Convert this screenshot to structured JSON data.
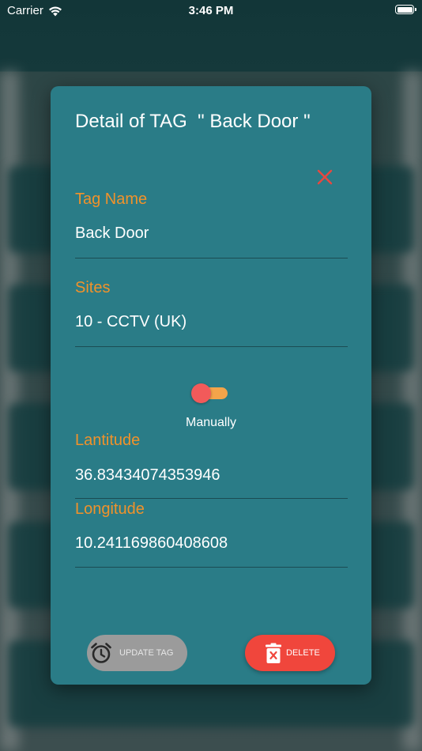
{
  "status_bar": {
    "carrier": "Carrier",
    "time": "3:46 PM"
  },
  "dialog": {
    "title": "Detail of TAG  \" Back Door \"",
    "close_icon": "close-icon",
    "fields": {
      "tag_name": {
        "label": "Tag Name",
        "value": "Back Door"
      },
      "sites": {
        "label": "Sites",
        "value": "10 - CCTV (UK)"
      },
      "latitude": {
        "label": "Lantitude",
        "value": "36.83434074353946"
      },
      "longitude": {
        "label": "Longitude",
        "value": "10.241169860408608"
      }
    },
    "toggle": {
      "caption": "Manually",
      "on": false
    },
    "buttons": {
      "update_label": "UPDATE TAG",
      "update_icon": "alarm-clock-icon",
      "delete_label": "DELETE",
      "delete_icon": "trash-icon"
    }
  },
  "colors": {
    "dialog_bg": "#2a7c87",
    "label": "#f1922a",
    "close": "#e8473f",
    "update_button": "#9b9b9b",
    "delete_button": "#f0463c",
    "toggle_track": "#f3a44a",
    "toggle_thumb": "#f25a5a"
  }
}
